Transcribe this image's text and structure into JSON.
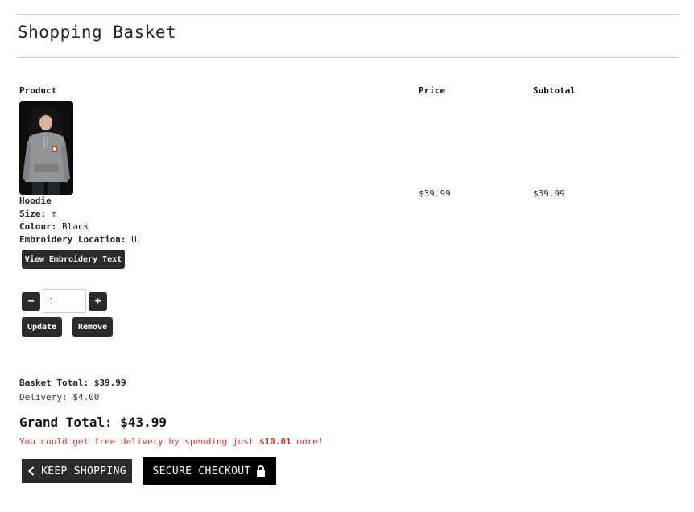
{
  "page": {
    "title": "Shopping Basket"
  },
  "table": {
    "headers": {
      "product": "Product",
      "price": "Price",
      "subtotal": "Subtotal"
    }
  },
  "item": {
    "name": "Hoodie",
    "attributes": [
      {
        "label": "Size:",
        "value": "m"
      },
      {
        "label": "Colour:",
        "value": "Black"
      },
      {
        "label": "Embroidery Location:",
        "value": "UL"
      }
    ],
    "view_embroidery_label": "View Embroidery Text",
    "price": "$39.99",
    "subtotal": "$39.99",
    "quantity": "1",
    "decrement_label": "−",
    "increment_label": "+",
    "update_label": "Update",
    "remove_label": "Remove"
  },
  "totals": {
    "basket_total_label": "Basket Total:",
    "basket_total": "$39.99",
    "delivery_label": "Delivery:",
    "delivery": "$4.00",
    "grand_total_label": "Grand Total:",
    "grand_total": "$43.99"
  },
  "notice": {
    "prefix": "You could get free delivery by spending just ",
    "amount": "$10.01",
    "suffix": " more!"
  },
  "actions": {
    "keep_shopping_label": "KEEP SHOPPING",
    "checkout_label": "SECURE CHECKOUT"
  },
  "icons": {
    "keep_shopping": "chevron-left-icon",
    "checkout": "lock-icon"
  },
  "colors": {
    "notice": "#c0392b",
    "button_dark": "#2b2b2b",
    "checkout_bg": "#000000"
  }
}
